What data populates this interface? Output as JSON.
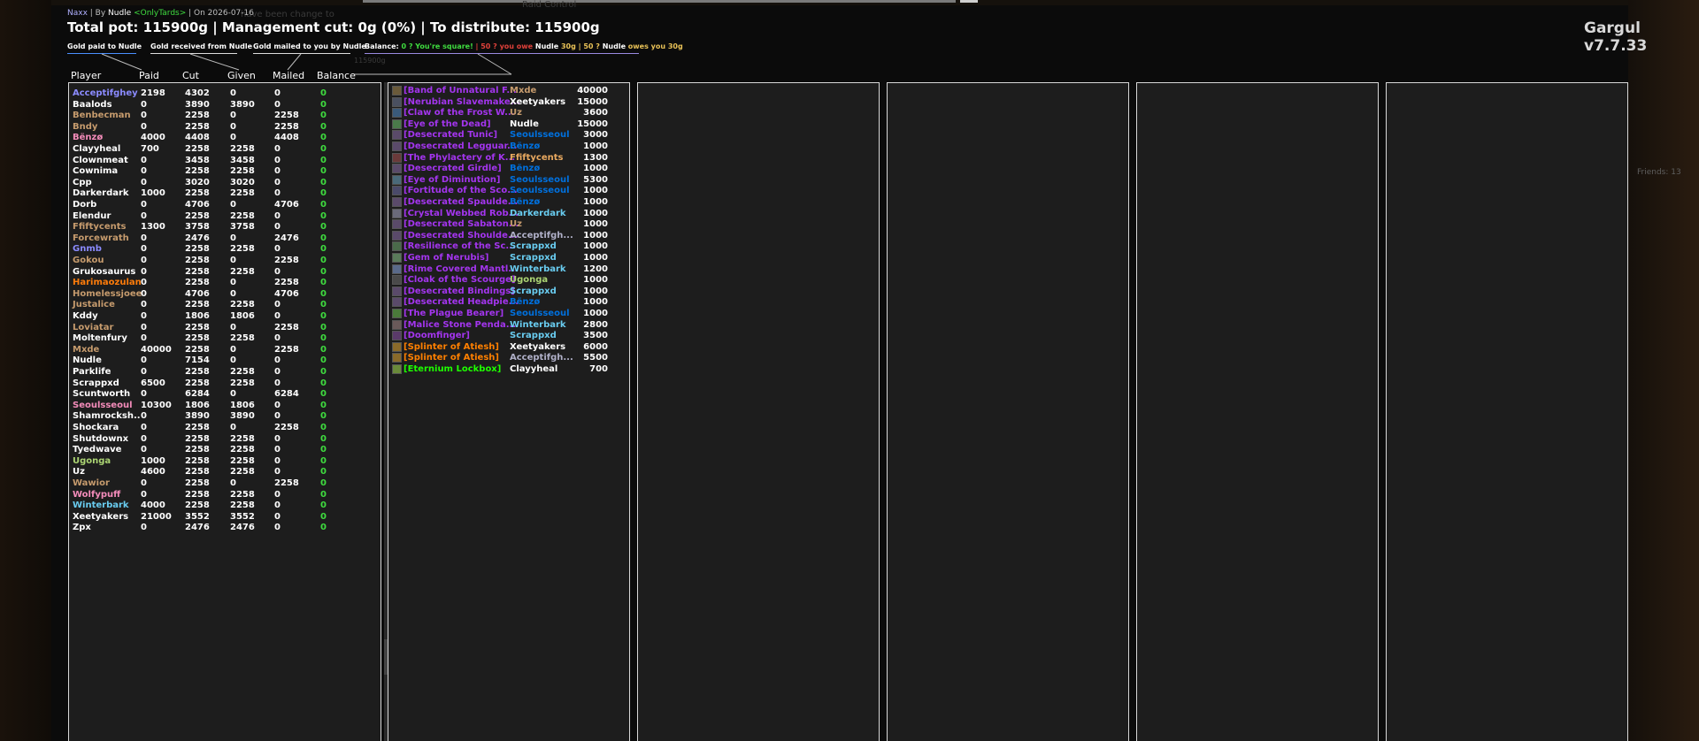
{
  "header": {
    "raid": "Naxx",
    "by_prefix": " | By ",
    "author": "Nudle",
    "guild": "<OnlyTards>",
    "date": " | On 2026-07-16",
    "title": "Total pot: 115900g | Management cut: 0g (0%) | To distribute: 115900g",
    "addon_version": "Gargul v7.7.33"
  },
  "legend": {
    "paid": "Gold paid to Nudle",
    "received": "Gold received from Nudle",
    "mailed": "Gold mailed to you by Nudle",
    "balance_label": "Balance:",
    "square": "0 ? You're square!",
    "you_owe": "| 50 ? you owe",
    "you_owe_name": "Nudle",
    "you_owe_amount": "30g",
    "owes_sep": "| 50 ?",
    "owes_name": "Nudle",
    "owes_text": "owes you",
    "owes_amount": "30g",
    "ghost_amount": "115900g"
  },
  "columns": [
    "Player",
    "Paid",
    "Cut",
    "Given",
    "Mailed",
    "Balance"
  ],
  "colors": {
    "square": "#3fdc3f",
    "owe": "#e0413a",
    "gold": "#e9c257",
    "panel_border": "#d8d8d8",
    "panel_bg": "#1d1d1d"
  },
  "players": [
    {
      "name": "Acceptifghey",
      "color": "#8b8bff",
      "paid": "2198",
      "cut": "4302",
      "given": "0",
      "mailed": "0",
      "balance": "0"
    },
    {
      "name": "Baalods",
      "color": "#ffffff",
      "paid": "0",
      "cut": "3890",
      "given": "3890",
      "mailed": "0",
      "balance": "0"
    },
    {
      "name": "Benbecman",
      "color": "#c69b6d",
      "paid": "0",
      "cut": "2258",
      "given": "0",
      "mailed": "2258",
      "balance": "0"
    },
    {
      "name": "Bndy",
      "color": "#c69b6d",
      "paid": "0",
      "cut": "2258",
      "given": "0",
      "mailed": "2258",
      "balance": "0"
    },
    {
      "name": "Bënzø",
      "color": "#f48cba",
      "paid": "4000",
      "cut": "4408",
      "given": "0",
      "mailed": "4408",
      "balance": "0"
    },
    {
      "name": "Clayyheal",
      "color": "#ffffff",
      "paid": "700",
      "cut": "2258",
      "given": "2258",
      "mailed": "0",
      "balance": "0"
    },
    {
      "name": "Clownmeat",
      "color": "#ffffff",
      "paid": "0",
      "cut": "3458",
      "given": "3458",
      "mailed": "0",
      "balance": "0"
    },
    {
      "name": "Cownima",
      "color": "#ffffff",
      "paid": "0",
      "cut": "2258",
      "given": "2258",
      "mailed": "0",
      "balance": "0"
    },
    {
      "name": "Cpp",
      "color": "#ffffff",
      "paid": "0",
      "cut": "3020",
      "given": "3020",
      "mailed": "0",
      "balance": "0"
    },
    {
      "name": "Darkerdark",
      "color": "#ffffff",
      "paid": "1000",
      "cut": "2258",
      "given": "2258",
      "mailed": "0",
      "balance": "0"
    },
    {
      "name": "Dorb",
      "color": "#ffffff",
      "paid": "0",
      "cut": "4706",
      "given": "0",
      "mailed": "4706",
      "balance": "0"
    },
    {
      "name": "Elendur",
      "color": "#ffffff",
      "paid": "0",
      "cut": "2258",
      "given": "2258",
      "mailed": "0",
      "balance": "0"
    },
    {
      "name": "Ffiftycents",
      "color": "#c69b6d",
      "paid": "1300",
      "cut": "3758",
      "given": "3758",
      "mailed": "0",
      "balance": "0"
    },
    {
      "name": "Forcewrath",
      "color": "#c69b6d",
      "paid": "0",
      "cut": "2476",
      "given": "0",
      "mailed": "2476",
      "balance": "0"
    },
    {
      "name": "Gnmb",
      "color": "#8b8bff",
      "paid": "0",
      "cut": "2258",
      "given": "2258",
      "mailed": "0",
      "balance": "0"
    },
    {
      "name": "Gokou",
      "color": "#c69b6d",
      "paid": "0",
      "cut": "2258",
      "given": "0",
      "mailed": "2258",
      "balance": "0"
    },
    {
      "name": "Grukosaurus",
      "color": "#ffffff",
      "paid": "0",
      "cut": "2258",
      "given": "2258",
      "mailed": "0",
      "balance": "0"
    },
    {
      "name": "Harimaozulan",
      "color": "#ff7c0a",
      "paid": "0",
      "cut": "2258",
      "given": "0",
      "mailed": "2258",
      "balance": "0"
    },
    {
      "name": "Homelessjoee",
      "color": "#c69b6d",
      "paid": "0",
      "cut": "4706",
      "given": "0",
      "mailed": "4706",
      "balance": "0"
    },
    {
      "name": "Justalice",
      "color": "#c69b6d",
      "paid": "0",
      "cut": "2258",
      "given": "2258",
      "mailed": "0",
      "balance": "0"
    },
    {
      "name": "Kddy",
      "color": "#ffffff",
      "paid": "0",
      "cut": "1806",
      "given": "1806",
      "mailed": "0",
      "balance": "0"
    },
    {
      "name": "Loviatar",
      "color": "#c69b6d",
      "paid": "0",
      "cut": "2258",
      "given": "0",
      "mailed": "2258",
      "balance": "0"
    },
    {
      "name": "Moltenfury",
      "color": "#ffffff",
      "paid": "0",
      "cut": "2258",
      "given": "2258",
      "mailed": "0",
      "balance": "0"
    },
    {
      "name": "Mxde",
      "color": "#c69b6d",
      "paid": "40000",
      "cut": "2258",
      "given": "0",
      "mailed": "2258",
      "balance": "0"
    },
    {
      "name": "Nudle",
      "color": "#ffffff",
      "paid": "0",
      "cut": "7154",
      "given": "0",
      "mailed": "0",
      "balance": "0"
    },
    {
      "name": "Parklife",
      "color": "#ffffff",
      "paid": "0",
      "cut": "2258",
      "given": "2258",
      "mailed": "0",
      "balance": "0"
    },
    {
      "name": "Scrappxd",
      "color": "#ffffff",
      "paid": "6500",
      "cut": "2258",
      "given": "2258",
      "mailed": "0",
      "balance": "0"
    },
    {
      "name": "Scuntworth",
      "color": "#ffffff",
      "paid": "0",
      "cut": "6284",
      "given": "0",
      "mailed": "6284",
      "balance": "0"
    },
    {
      "name": "Seoulsseoul",
      "color": "#f48cba",
      "paid": "10300",
      "cut": "1806",
      "given": "1806",
      "mailed": "0",
      "balance": "0"
    },
    {
      "name": "Shamrocksh..",
      "color": "#ffffff",
      "paid": "0",
      "cut": "3890",
      "given": "3890",
      "mailed": "0",
      "balance": "0"
    },
    {
      "name": "Shockara",
      "color": "#ffffff",
      "paid": "0",
      "cut": "2258",
      "given": "0",
      "mailed": "2258",
      "balance": "0"
    },
    {
      "name": "Shutdownx",
      "color": "#ffffff",
      "paid": "0",
      "cut": "2258",
      "given": "2258",
      "mailed": "0",
      "balance": "0"
    },
    {
      "name": "Tyedwave",
      "color": "#ffffff",
      "paid": "0",
      "cut": "2258",
      "given": "2258",
      "mailed": "0",
      "balance": "0"
    },
    {
      "name": "Ugonga",
      "color": "#abd473",
      "paid": "1000",
      "cut": "2258",
      "given": "2258",
      "mailed": "0",
      "balance": "0"
    },
    {
      "name": "Uz",
      "color": "#ffffff",
      "paid": "4600",
      "cut": "2258",
      "given": "2258",
      "mailed": "0",
      "balance": "0"
    },
    {
      "name": "Wawior",
      "color": "#c69b6d",
      "paid": "0",
      "cut": "2258",
      "given": "0",
      "mailed": "2258",
      "balance": "0"
    },
    {
      "name": "Wolfypuff",
      "color": "#f48cba",
      "paid": "0",
      "cut": "2258",
      "given": "2258",
      "mailed": "0",
      "balance": "0"
    },
    {
      "name": "Winterbark",
      "color": "#69ccf0",
      "paid": "4000",
      "cut": "2258",
      "given": "2258",
      "mailed": "0",
      "balance": "0"
    },
    {
      "name": "Xeetyakers",
      "color": "#ffffff",
      "paid": "21000",
      "cut": "3552",
      "given": "3552",
      "mailed": "0",
      "balance": "0"
    },
    {
      "name": "Zpx",
      "color": "#ffffff",
      "paid": "0",
      "cut": "2476",
      "given": "2476",
      "mailed": "0",
      "balance": "0"
    }
  ],
  "items": [
    {
      "item": "[Band of Unnatural F...",
      "quality": "#a335ee",
      "winner": "Mxde",
      "winner_color": "#c69b6d",
      "price": "40000",
      "icon": "#6a5a3a"
    },
    {
      "item": "[Nerubian Slavemake...",
      "quality": "#a335ee",
      "winner": "Xeetyakers",
      "winner_color": "#ffffff",
      "price": "15000",
      "icon": "#4a5060"
    },
    {
      "item": "[Claw of the Frost W...",
      "quality": "#a335ee",
      "winner": "Uz",
      "winner_color": "#c69b6d",
      "price": "3600",
      "icon": "#3a5a7a"
    },
    {
      "item": "[Eye of the Dead]",
      "quality": "#a335ee",
      "winner": "Nudle",
      "winner_color": "#ffffff",
      "price": "15000",
      "icon": "#4a7a4a"
    },
    {
      "item": "[Desecrated Tunic]",
      "quality": "#a335ee",
      "winner": "Seoulsseoul",
      "winner_color": "#0070dd",
      "price": "3000",
      "icon": "#5a4a6a"
    },
    {
      "item": "[Desecrated Legguar...",
      "quality": "#a335ee",
      "winner": "Bënzø",
      "winner_color": "#0070dd",
      "price": "1000",
      "icon": "#5a4a6a"
    },
    {
      "item": "[The Phylactery of K...",
      "quality": "#a335ee",
      "winner": "Ffiftycents",
      "winner_color": "#e9a960",
      "price": "1300",
      "icon": "#6a3a3a"
    },
    {
      "item": "[Desecrated Girdle]",
      "quality": "#a335ee",
      "winner": "Bënzø",
      "winner_color": "#0070dd",
      "price": "1000",
      "icon": "#5a4a6a"
    },
    {
      "item": "[Eye of Diminution]",
      "quality": "#a335ee",
      "winner": "Seoulsseoul",
      "winner_color": "#0070dd",
      "price": "5300",
      "icon": "#4a6a7a"
    },
    {
      "item": "[Fortitude of the Sco...",
      "quality": "#a335ee",
      "winner": "Seoulsseoul",
      "winner_color": "#0070dd",
      "price": "1000",
      "icon": "#4a4a6a"
    },
    {
      "item": "[Desecrated Spaulde...",
      "quality": "#a335ee",
      "winner": "Bënzø",
      "winner_color": "#0070dd",
      "price": "1000",
      "icon": "#5a4a6a"
    },
    {
      "item": "[Crystal Webbed Rob...",
      "quality": "#a335ee",
      "winner": "Darkerdark",
      "winner_color": "#69ccf0",
      "price": "1000",
      "icon": "#6a6a7a"
    },
    {
      "item": "[Desecrated Sabaton...",
      "quality": "#a335ee",
      "winner": "Uz",
      "winner_color": "#c69b6d",
      "price": "1000",
      "icon": "#5a4a6a"
    },
    {
      "item": "[Desecrated Shoulde...",
      "quality": "#a335ee",
      "winner": "Acceptifgh...",
      "winner_color": "#b0b0c8",
      "price": "1000",
      "icon": "#5a4a6a"
    },
    {
      "item": "[Resilience of the Sc...",
      "quality": "#a335ee",
      "winner": "Scrappxd",
      "winner_color": "#69ccf0",
      "price": "1000",
      "icon": "#4a6a4a"
    },
    {
      "item": "[Gem of Nerubis]",
      "quality": "#a335ee",
      "winner": "Scrappxd",
      "winner_color": "#69ccf0",
      "price": "1000",
      "icon": "#5a7a5a"
    },
    {
      "item": "[Rime Covered Mantl...",
      "quality": "#a335ee",
      "winner": "Winterbark",
      "winner_color": "#69ccf0",
      "price": "1200",
      "icon": "#5a6a8a"
    },
    {
      "item": "[Cloak of the Scourge]",
      "quality": "#a335ee",
      "winner": "Ugonga",
      "winner_color": "#abd473",
      "price": "1000",
      "icon": "#4a4a4a"
    },
    {
      "item": "[Desecrated Bindings]",
      "quality": "#a335ee",
      "winner": "Scrappxd",
      "winner_color": "#69ccf0",
      "price": "1000",
      "icon": "#5a4a6a"
    },
    {
      "item": "[Desecrated Headpie...",
      "quality": "#a335ee",
      "winner": "Bënzø",
      "winner_color": "#0070dd",
      "price": "1000",
      "icon": "#5a4a6a"
    },
    {
      "item": "[The Plague Bearer]",
      "quality": "#a335ee",
      "winner": "Seoulsseoul",
      "winner_color": "#0070dd",
      "price": "1000",
      "icon": "#4a7a3a"
    },
    {
      "item": "[Malice Stone Penda...",
      "quality": "#a335ee",
      "winner": "Winterbark",
      "winner_color": "#69ccf0",
      "price": "2800",
      "icon": "#6a5a5a"
    },
    {
      "item": "[Doomfinger]",
      "quality": "#a335ee",
      "winner": "Scrappxd",
      "winner_color": "#69ccf0",
      "price": "3500",
      "icon": "#5a3a6a"
    },
    {
      "item": "[Splinter of Atiesh]",
      "quality": "#ff8000",
      "winner": "Xeetyakers",
      "winner_color": "#ffffff",
      "price": "6000",
      "icon": "#8a6a2a"
    },
    {
      "item": "[Splinter of Atiesh]",
      "quality": "#ff8000",
      "winner": "Acceptifgh...",
      "winner_color": "#b0b0c8",
      "price": "5500",
      "icon": "#8a6a2a"
    },
    {
      "item": "[Eternium Lockbox]",
      "quality": "#1eff00",
      "winner": "Clayyheal",
      "winner_color": "#ffffff",
      "price": "700",
      "icon": "#6a8a3a"
    }
  ],
  "background_ui": {
    "faded_top": "Raid Control",
    "faded_notice": "have been change to",
    "friends": "Friends: 13"
  }
}
